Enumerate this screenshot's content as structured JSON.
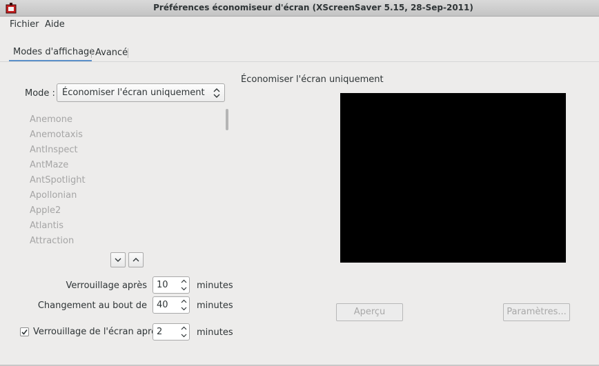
{
  "window": {
    "title": "Préférences économiseur d'écran  (XScreenSaver 5.15, 28-Sep-2011)"
  },
  "menu": [
    "Fichier",
    "Aide"
  ],
  "tabs": [
    {
      "label": "Modes d'affichage",
      "active": true
    },
    {
      "label": "Avancé",
      "active": false
    }
  ],
  "mode": {
    "label": "Mode :",
    "value": "Économiser l'écran uniquement"
  },
  "screensavers": [
    "Anemone",
    "Anemotaxis",
    "AntInspect",
    "AntMaze",
    "AntSpotlight",
    "Apollonian",
    "Apple2",
    "Atlantis",
    "Attraction"
  ],
  "settings": {
    "lock_after": {
      "label": "Verrouillage après",
      "value": "10",
      "unit": "minutes"
    },
    "cycle_after": {
      "label": "Changement au bout de",
      "value": "40",
      "unit": "minutes"
    },
    "lock_screen": {
      "label": "Verrouillage de l'écran après",
      "value": "2",
      "unit": "minutes",
      "checked": true
    }
  },
  "preview": {
    "title": "Économiser l'écran uniquement",
    "preview_button": "Aperçu",
    "settings_button": "Paramètres..."
  },
  "colors": {
    "window_bg": "#edeceb",
    "preview_bg": "#000000",
    "tab_accent": "#5a8fc9"
  },
  "icons": {
    "app": "xscreensaver-app-icon",
    "move_down": "chevron-down-icon",
    "move_up": "chevron-up-icon",
    "select_arrows": "updown-arrows-icon"
  }
}
